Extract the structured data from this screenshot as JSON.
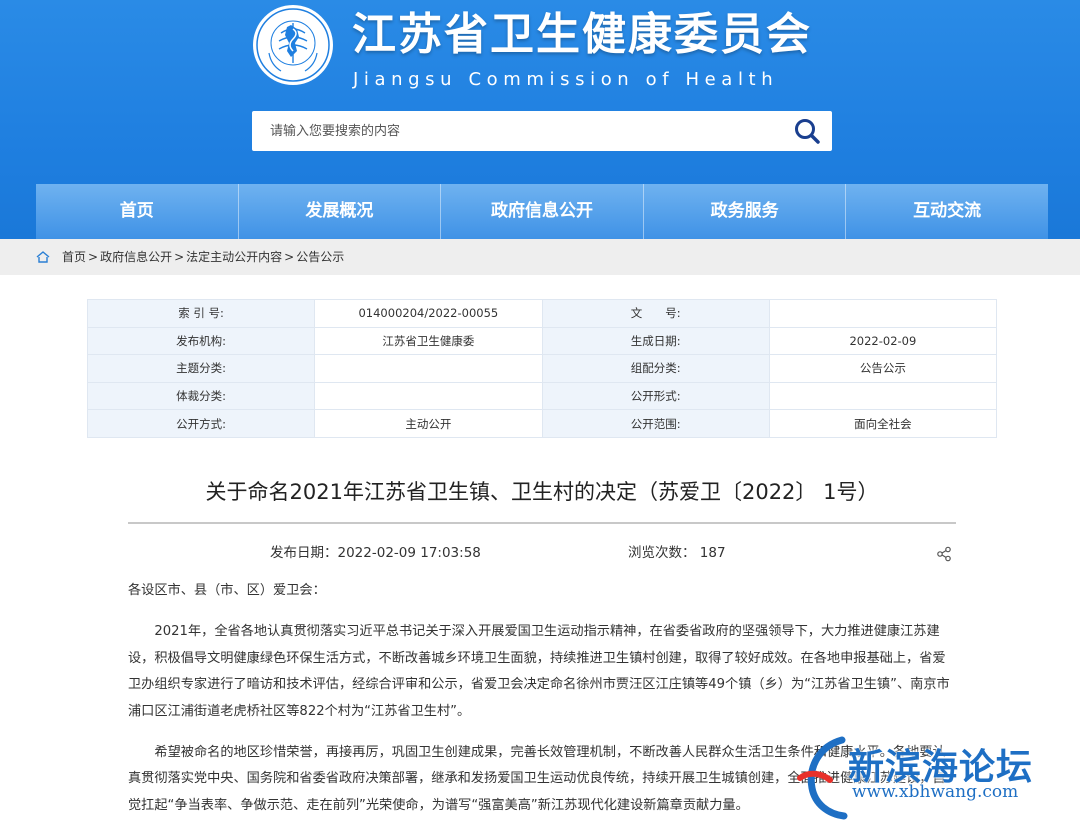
{
  "header": {
    "title": "江苏省卫生健康委员会",
    "subtitle": "Jiangsu Commission of Health",
    "logo_text": "Jiangsu Commission of Health",
    "search_placeholder": "请输入您要搜索的内容"
  },
  "nav": {
    "items": [
      "首页",
      "发展概况",
      "政府信息公开",
      "政务服务",
      "互动交流"
    ]
  },
  "breadcrumb": {
    "items": [
      "首页",
      "政府信息公开",
      "法定主动公开内容",
      "公告公示"
    ]
  },
  "meta": {
    "rows": [
      {
        "l1": "索 引 号:",
        "v1": "014000204/2022-00055",
        "l2": "文　　号:",
        "v2": ""
      },
      {
        "l1": "发布机构:",
        "v1": "江苏省卫生健康委",
        "l2": "生成日期:",
        "v2": "2022-02-09"
      },
      {
        "l1": "主题分类:",
        "v1": "",
        "l2": "组配分类:",
        "v2": "公告公示"
      },
      {
        "l1": "体裁分类:",
        "v1": "",
        "l2": "公开形式:",
        "v2": ""
      },
      {
        "l1": "公开方式:",
        "v1": "主动公开",
        "l2": "公开范围:",
        "v2": "面向全社会"
      }
    ]
  },
  "article": {
    "title": "关于命名2021年江苏省卫生镇、卫生村的决定（苏爱卫〔2022〕 1号）",
    "publish_date": "发布日期：2022-02-09 17:03:58",
    "views": "浏览次数： 187",
    "salutation": "各设区市、县（市、区）爱卫会：",
    "para1": "2021年，全省各地认真贯彻落实习近平总书记关于深入开展爱国卫生运动指示精神，在省委省政府的坚强领导下，大力推进健康江苏建设，积极倡导文明健康绿色环保生活方式，不断改善城乡环境卫生面貌，持续推进卫生镇村创建，取得了较好成效。在各地申报基础上，省爱卫办组织专家进行了暗访和技术评估，经综合评审和公示，省爱卫会决定命名徐州市贾汪区江庄镇等49个镇（乡）为“江苏省卫生镇”、南京市浦口区江浦街道老虎桥社区等822个村为“江苏省卫生村”。",
    "para2": "希望被命名的地区珍惜荣誉，再接再厉，巩固卫生创建成果，完善长效管理机制，不断改善人民群众生活卫生条件和健康水平。各地要认真贯彻落实党中央、国务院和省委省政府决策部署，继承和发扬爱国卫生运动优良传统，持续开展卫生城镇创建，全面推进健康江苏建设，自觉扛起“争当表率、争做示范、走在前列”光荣使命，为谱写“强富美高”新江苏现代化建设新篇章贡献力量。"
  },
  "watermark": {
    "text": "新滨海论坛",
    "url": "www.xbhwang.com"
  },
  "colors": {
    "header_blue": "#1f7fe0",
    "nav_top": "#6fb2f0",
    "nav_bottom": "#3f92e6",
    "table_label_bg": "#eef4fb",
    "watermark_blue": "#1e6fc4"
  }
}
